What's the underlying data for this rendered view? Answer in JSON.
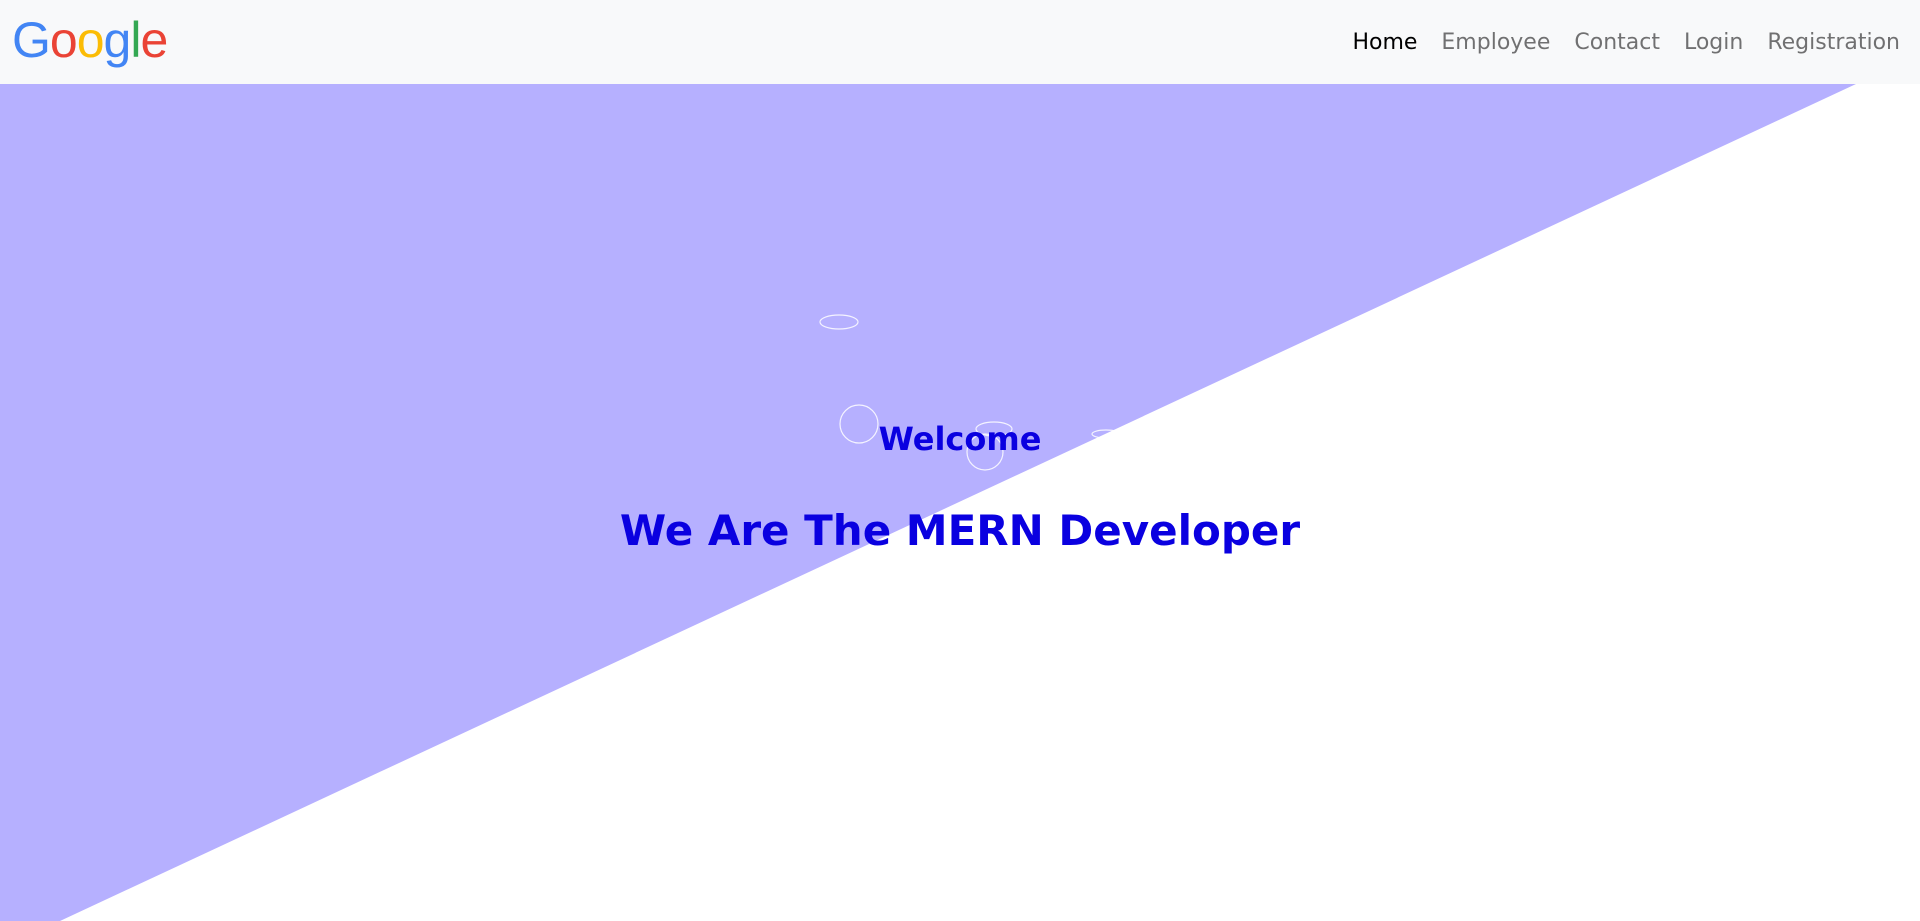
{
  "navbar": {
    "logo": {
      "letters": [
        "G",
        "o",
        "o",
        "g",
        "l",
        "e"
      ],
      "colors": [
        "#4285F4",
        "#EA4335",
        "#FBBC05",
        "#4285F4",
        "#34A853",
        "#EA4335"
      ]
    },
    "links": [
      {
        "label": "Home",
        "active": true
      },
      {
        "label": "Employee",
        "active": false
      },
      {
        "label": "Contact",
        "active": false
      },
      {
        "label": "Login",
        "active": false
      },
      {
        "label": "Registration",
        "active": false
      }
    ]
  },
  "hero": {
    "welcome": "Welcome",
    "tagline": "We Are The MERN Developer"
  },
  "colors": {
    "hero_bg": "#b6b0ff",
    "heading": "#0a00e0",
    "navbar_bg": "#f8f9fa"
  }
}
